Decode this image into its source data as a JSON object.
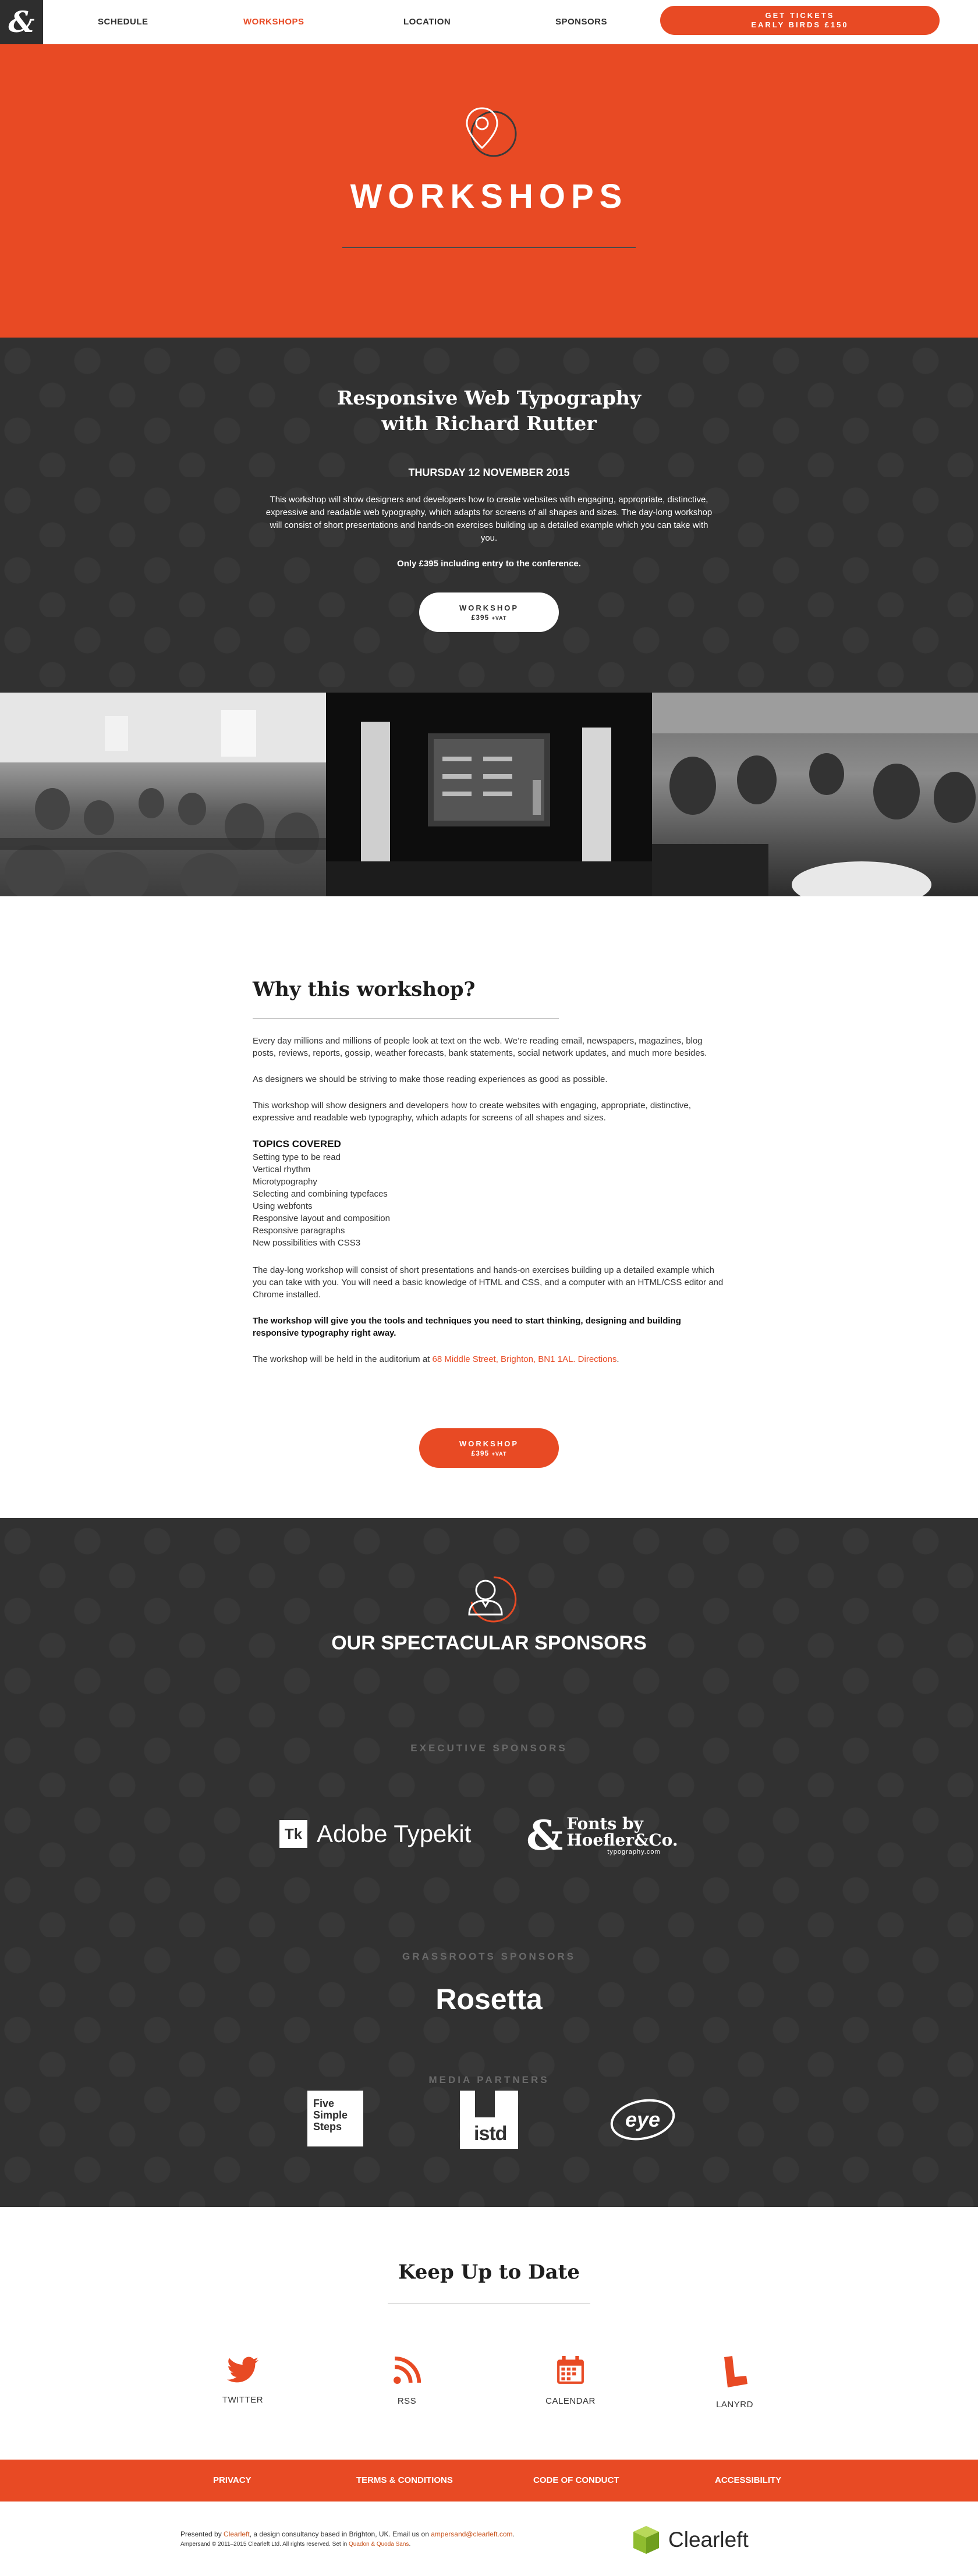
{
  "nav": {
    "logo": "&",
    "links": [
      "SCHEDULE",
      "WORKSHOPS",
      "LOCATION",
      "SPONSORS"
    ],
    "active": "WORKSHOPS",
    "tickets_line1": "GET TICKETS",
    "tickets_line2": "EARLY BIRDS £150"
  },
  "hero": {
    "title": "WORKSHOPS",
    "icon": "location-pin-icon"
  },
  "workshop": {
    "title_line1": "Responsive Web Typography",
    "title_line2": "with Richard Rutter",
    "date": "THURSDAY 12 NOVEMBER 2015",
    "description": "This workshop will show designers and developers how to create websites with engaging, appropriate, distinctive, expressive and readable web typography, which adapts for screens of all shapes and sizes. The day-long workshop will consist of short presentations and hands-on exercises building up a detailed example which you can take with you.",
    "price_note": "Only £395 including entry to the conference.",
    "button_label": "WORKSHOP",
    "button_price": "£395",
    "button_vat": "+VAT"
  },
  "why": {
    "heading": "Why this workshop?",
    "p1": "Every day millions and millions of people look at text on the web. We’re reading email, newspapers, magazines, blog posts, reviews, reports, gossip, weather forecasts, bank statements, social network updates, and much more besides.",
    "p2": "As designers we should be striving to make those reading experiences as good as possible.",
    "p3": "This workshop will show designers and developers how to create websites with engaging, appropriate, distinctive, expressive and readable web typography, which adapts for screens of all shapes and sizes.",
    "topics_heading": "TOPICS COVERED",
    "topics": [
      "Setting type to be read",
      "Vertical rhythm",
      "Microtypography",
      "Selecting and combining typefaces",
      "Using webfonts",
      "Responsive layout and composition",
      "Responsive paragraphs",
      "New possibilities with CSS3"
    ],
    "p4": "The day-long workshop will consist of short presentations and hands-on exercises building up a detailed example which you can take with you. You will need a basic knowledge of HTML and CSS, and a computer with an HTML/CSS editor and Chrome installed.",
    "p5": "The workshop will give you the tools and techniques you need to start thinking, designing and building responsive typography right away.",
    "p6_prefix": "The workshop will be held in the auditorium at ",
    "p6_address": "68 Middle Street, Brighton, BN1 1AL.",
    "p6_directions": "Directions",
    "p6_end": "."
  },
  "sponsors": {
    "heading": "OUR SPECTACULAR SPONSORS",
    "icon": "person-icon",
    "executive_label": "EXECUTIVE SPONSORS",
    "typekit_mark": "Tk",
    "typekit_name": "Adobe Typekit",
    "hoefler_amp": "&",
    "hoefler_line1": "Fonts by",
    "hoefler_line2": "Hoefler&Co.",
    "hoefler_url": "typography.com",
    "grassroots_label": "GRASSROOTS SPONSORS",
    "rosetta": "Rosetta",
    "media_label": "MEDIA PARTNERS",
    "fss": [
      "Five",
      "Simple",
      "Steps"
    ],
    "istd": "istd",
    "eye": "eye"
  },
  "keep": {
    "heading": "Keep Up to Date",
    "items": [
      {
        "label": "TWITTER",
        "icon": "twitter-icon"
      },
      {
        "label": "RSS",
        "icon": "rss-icon"
      },
      {
        "label": "CALENDAR",
        "icon": "calendar-icon"
      },
      {
        "label": "LANYRD",
        "icon": "lanyrd-icon"
      }
    ]
  },
  "footer": {
    "links": [
      "PRIVACY",
      "TERMS & CONDITIONS",
      "CODE OF CONDUCT",
      "ACCESSIBILITY"
    ],
    "presented_prefix": "Presented by ",
    "clearleft_link": "Clearleft",
    "presented_mid": ", a design consultancy based in Brighton, UK. Email us on ",
    "email": "ampersand@clearleft.com",
    "presented_end": ".",
    "copyright_prefix": "Ampersand © 2011–2015 Clearleft Ltd. All rights reserved. Set in ",
    "fonts_link": "Quadon & Quoda Sans",
    "copyright_end": ".",
    "brand": "Clearleft"
  },
  "colors": {
    "accent": "#e84a24",
    "dark": "#313131",
    "text": "#2f2f2f"
  }
}
